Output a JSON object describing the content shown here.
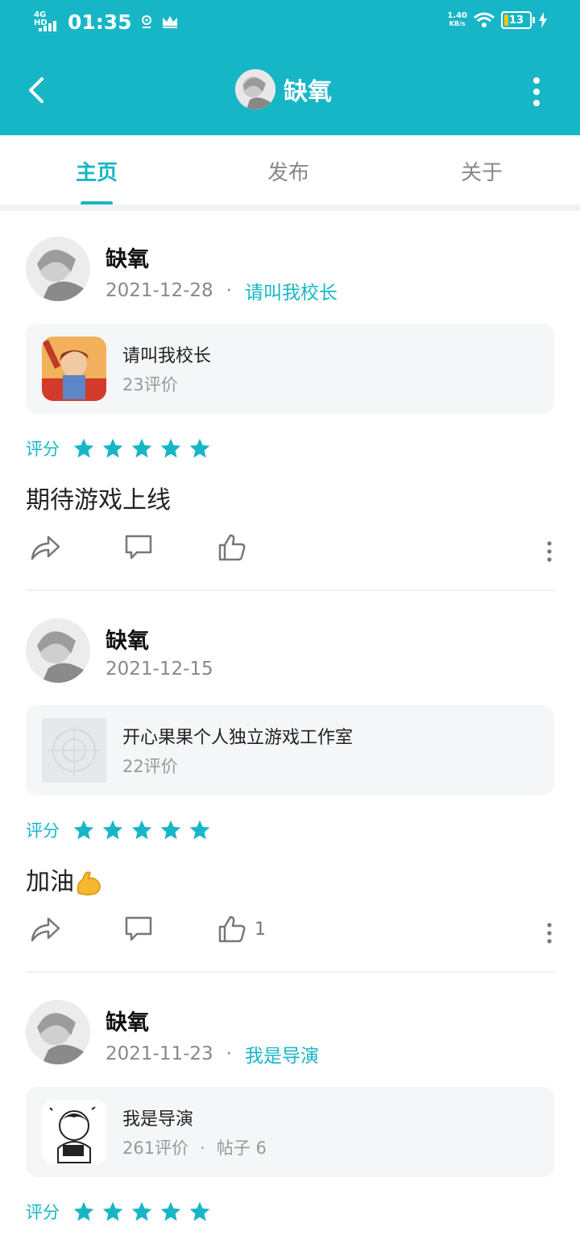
{
  "status_bar": {
    "network": "4G HD",
    "time": "01:35",
    "speed_value": "1.40",
    "speed_unit": "KB/s",
    "battery": "13"
  },
  "header": {
    "title": "缺氧",
    "back_icon": "back-arrow-icon",
    "menu_icon": "more-vertical-icon"
  },
  "tabs": [
    {
      "label": "主页",
      "active": true
    },
    {
      "label": "发布",
      "active": false
    },
    {
      "label": "关于",
      "active": false
    }
  ],
  "colors": {
    "accent": "#17b6c6",
    "card_bg": "#f5f6f8"
  },
  "posts": [
    {
      "author": "缺氧",
      "date": "2021-12-28",
      "separator": "·",
      "game_link": "请叫我校长",
      "card": {
        "title": "请叫我校长",
        "reviews": "23评价",
        "posts": ""
      },
      "rating_label": "评分",
      "stars": 5,
      "text": "期待游戏上线",
      "likes": ""
    },
    {
      "author": "缺氧",
      "date": "2021-12-15",
      "separator": "",
      "game_link": "",
      "card": {
        "title": "开心果果个人独立游戏工作室",
        "reviews": "22评价",
        "posts": ""
      },
      "rating_label": "评分",
      "stars": 5,
      "text": "加油",
      "likes": "1"
    },
    {
      "author": "缺氧",
      "date": "2021-11-23",
      "separator": "·",
      "game_link": "我是导演",
      "card": {
        "title": "我是导演",
        "reviews": "261评价",
        "separator": "·",
        "posts": "帖子 6"
      },
      "rating_label": "评分",
      "stars": 5,
      "text": "",
      "likes": ""
    }
  ]
}
